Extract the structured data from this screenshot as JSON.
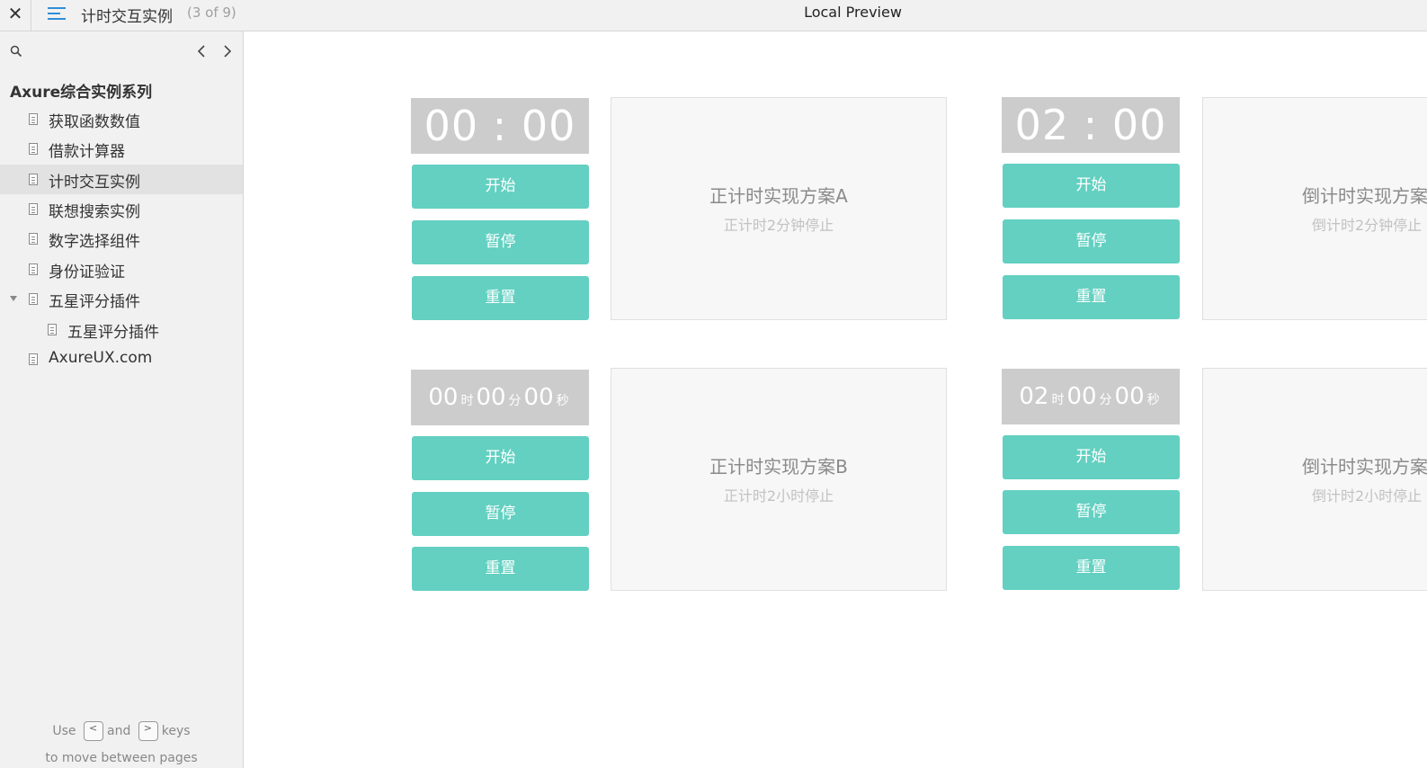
{
  "topbar": {
    "close_glyph": "✕",
    "page_title": "计时交互实例",
    "page_count": "(3 of 9)",
    "preview_title": "Local Preview"
  },
  "sidebar": {
    "root_label": "Axure综合实例系列",
    "items": [
      {
        "label": "获取函数数值"
      },
      {
        "label": "借款计算器"
      },
      {
        "label": "计时交互实例",
        "selected": true
      },
      {
        "label": "联想搜索实例"
      },
      {
        "label": "数字选择组件"
      },
      {
        "label": "身份证验证"
      },
      {
        "label": "五星评分插件",
        "expanded": true
      },
      {
        "label": "五星评分插件"
      },
      {
        "label": "AxureUX.com"
      }
    ],
    "hint": {
      "use": "Use",
      "and": "and",
      "keys": "keys",
      "line2": "to move between pages",
      "key_prev": "<",
      "key_next": ">"
    }
  },
  "timers": [
    {
      "display": "00 : 00",
      "buttons": {
        "start": "开始",
        "pause": "暂停",
        "reset": "重置"
      },
      "panel_title": "正计时实现方案A",
      "panel_sub": "正计时2分钟停止"
    },
    {
      "display": "02 : 00",
      "buttons": {
        "start": "开始",
        "pause": "暂停",
        "reset": "重置"
      },
      "panel_title": "倒计时实现方案A",
      "panel_sub": "倒计时2分钟停止"
    },
    {
      "display_parts": {
        "h": "00",
        "h_unit": "时",
        "m": "00",
        "m_unit": "分",
        "s": "00",
        "s_unit": "秒"
      },
      "buttons": {
        "start": "开始",
        "pause": "暂停",
        "reset": "重置"
      },
      "panel_title": "正计时实现方案B",
      "panel_sub": "正计时2小时停止"
    },
    {
      "display_parts": {
        "h": "02",
        "h_unit": "时",
        "m": "00",
        "m_unit": "分",
        "s": "00",
        "s_unit": "秒"
      },
      "buttons": {
        "start": "开始",
        "pause": "暂停",
        "reset": "重置"
      },
      "panel_title": "倒计时实现方案B",
      "panel_sub": "倒计时2小时停止"
    }
  ],
  "colors": {
    "accent": "#63d0c1",
    "display_bg": "#cccccc",
    "panel_bg": "#f7f7f7",
    "menu_icon": "#2f8fd8"
  }
}
